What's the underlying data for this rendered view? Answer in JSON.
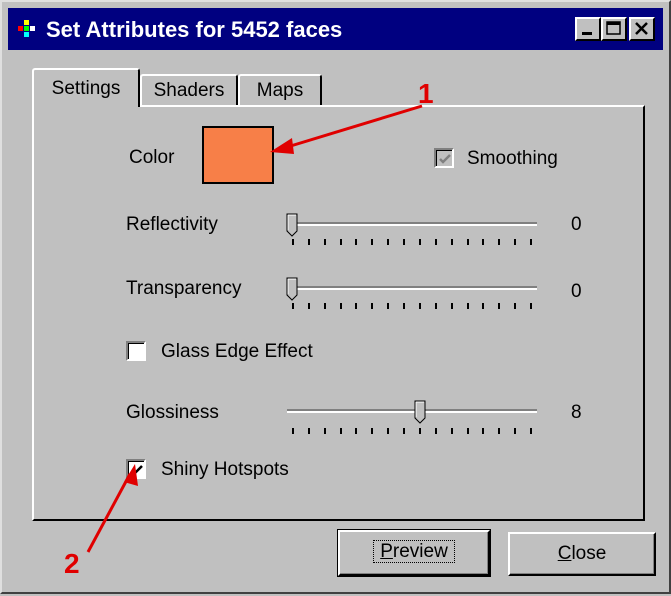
{
  "window": {
    "title": "Set Attributes for 5452 faces",
    "controls": [
      "minimize-icon",
      "maximize-icon",
      "close-icon"
    ]
  },
  "tabs": [
    {
      "label": "Settings",
      "selected": true
    },
    {
      "label": "Shaders",
      "selected": false
    },
    {
      "label": "Maps",
      "selected": false
    }
  ],
  "settings": {
    "color_label": "Color",
    "color_value": "#f77f48",
    "smoothing": {
      "label": "Smoothing",
      "checked": true,
      "enabled": false
    },
    "reflectivity": {
      "label": "Reflectivity",
      "value": "0"
    },
    "transparency": {
      "label": "Transparency",
      "value": "0"
    },
    "glass_edge": {
      "label": "Glass Edge Effect",
      "checked": false
    },
    "glossiness": {
      "label": "Glossiness",
      "value": "8"
    },
    "shiny_hotspots": {
      "label": "Shiny Hotspots",
      "checked": true
    }
  },
  "buttons": {
    "preview_prefix": "P",
    "preview_rest": "review",
    "close_prefix": "C",
    "close_rest": "lose"
  },
  "annotations": {
    "one": "1",
    "two": "2",
    "color": "#e00000"
  }
}
